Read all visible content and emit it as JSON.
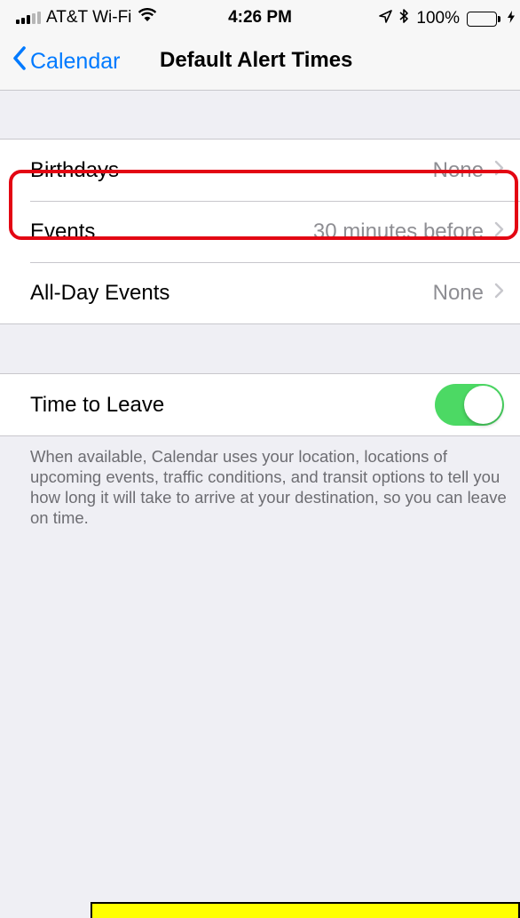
{
  "status_bar": {
    "carrier": "AT&T Wi-Fi",
    "time": "4:26 PM",
    "battery_percent": "100%",
    "battery_level": 1.0,
    "icons": [
      "signal-icon",
      "wifi-icon",
      "location-arrow-icon",
      "bluetooth-icon",
      "battery-icon",
      "charging-icon"
    ]
  },
  "nav": {
    "back_label": "Calendar",
    "title": "Default Alert Times"
  },
  "alerts": {
    "rows": [
      {
        "label": "Birthdays",
        "value": "None"
      },
      {
        "label": "Events",
        "value": "30 minutes before"
      },
      {
        "label": "All-Day Events",
        "value": "None"
      }
    ]
  },
  "time_to_leave": {
    "label": "Time to Leave",
    "enabled": true,
    "description": "When available, Calendar uses your location, locations of upcoming events, traffic conditions, and transit options to tell you how long it will take to arrive at your destination, so you can leave on time."
  },
  "colors": {
    "accent": "#007aff",
    "toggle_on": "#4cd964",
    "highlight": "#e30613",
    "annotation_box": "#ffff00"
  }
}
